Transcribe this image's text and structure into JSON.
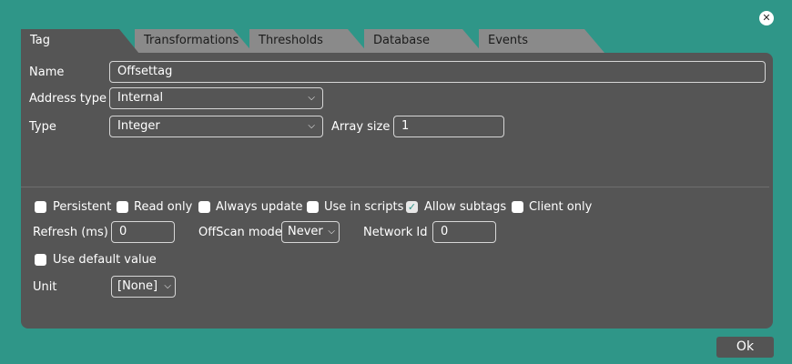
{
  "window": {
    "close_glyph": "✕"
  },
  "tabs": [
    {
      "label": "Tag",
      "active": true
    },
    {
      "label": "Transformations",
      "active": false
    },
    {
      "label": "Thresholds",
      "active": false
    },
    {
      "label": "Database",
      "active": false
    },
    {
      "label": "Events",
      "active": false
    }
  ],
  "form": {
    "name_label": "Name",
    "name_value": "Offsettag",
    "address_type_label": "Address type",
    "address_type_value": "Internal",
    "type_label": "Type",
    "type_value": "Integer",
    "array_size_label": "Array size",
    "array_size_value": "1"
  },
  "options": {
    "checkboxes": [
      {
        "label": "Persistent",
        "checked": false
      },
      {
        "label": "Read only",
        "checked": false
      },
      {
        "label": "Always update",
        "checked": false
      },
      {
        "label": "Use in scripts",
        "checked": false
      },
      {
        "label": "Allow subtags",
        "checked": true
      },
      {
        "label": "Client only",
        "checked": false
      }
    ],
    "refresh_label": "Refresh (ms)",
    "refresh_value": "0",
    "offscan_label": "OffScan mode",
    "offscan_value": "Never",
    "network_id_label": "Network Id",
    "network_id_value": "0",
    "use_default_label": "Use default value",
    "use_default_checked": false,
    "unit_label": "Unit",
    "unit_value": "[None]"
  },
  "footer": {
    "ok_label": "Ok"
  },
  "icons": {
    "chevron": "chevron-down-icon",
    "check": "check-icon",
    "close": "close-icon"
  },
  "colors": {
    "background": "#2f9688",
    "panel": "#555555",
    "tab_inactive": "#8a8a8a",
    "check": "#2f9688"
  }
}
